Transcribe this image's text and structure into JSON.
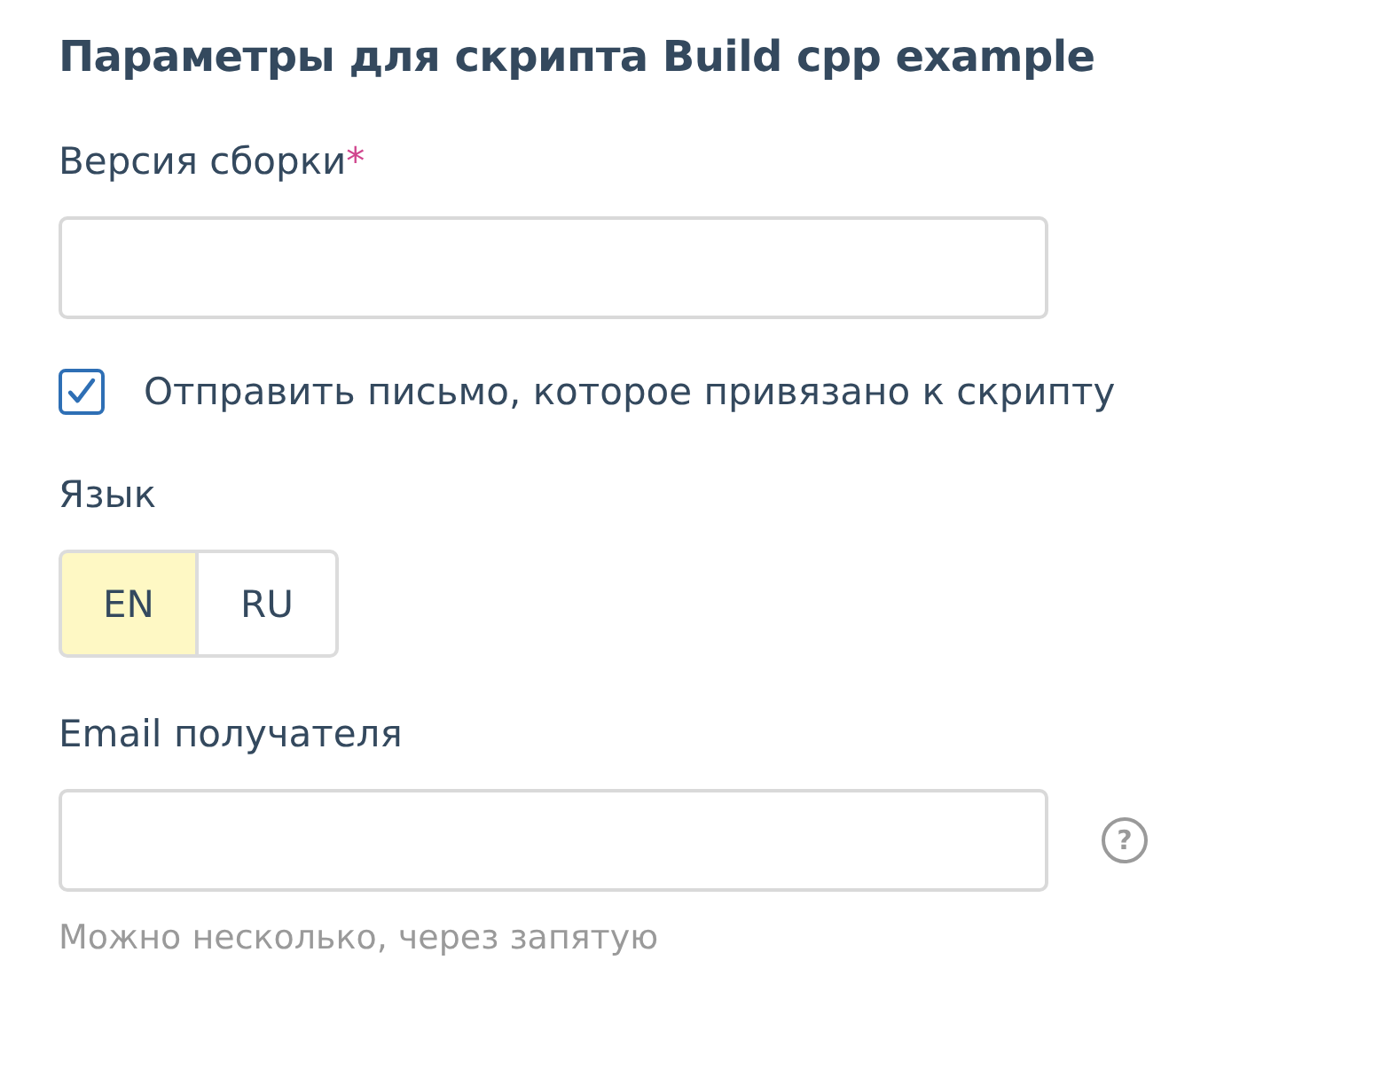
{
  "title": "Параметры для скрипта Build cpp example",
  "fields": [
    {
      "kind": "text",
      "label": "Версия сборки",
      "required_mark": "*"
    },
    {
      "kind": "checkbox",
      "label": "Отправить письмо, которое привязано к скрипту",
      "checked": true
    },
    {
      "kind": "segmented",
      "label": "Язык",
      "options": [
        {
          "label": "EN",
          "selected": true
        },
        {
          "label": "RU",
          "selected": false
        }
      ]
    },
    {
      "kind": "text",
      "label": "Email получателя",
      "help": "?",
      "hint": "Можно несколько, через запятую"
    }
  ]
}
